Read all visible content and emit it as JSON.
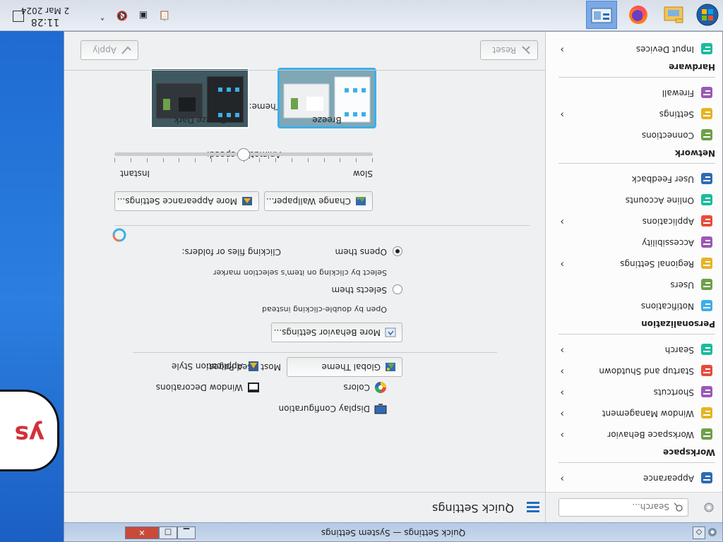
{
  "window": {
    "title": "Quick Settings — System Settings"
  },
  "sidebar": {
    "search_placeholder": "Search...",
    "items": [
      {
        "label": "Appearance",
        "icon": "appearance-icon",
        "chevron": true
      },
      {
        "category": "Workspace"
      },
      {
        "label": "Workspace Behavior",
        "icon": "workspace-behavior-icon",
        "chevron": true
      },
      {
        "label": "Window Management",
        "icon": "window-management-icon",
        "chevron": true
      },
      {
        "label": "Shortcuts",
        "icon": "shortcuts-icon",
        "chevron": true
      },
      {
        "label": "Startup and Shutdown",
        "icon": "startup-icon",
        "chevron": true
      },
      {
        "label": "Search",
        "icon": "search-icon",
        "chevron": true
      },
      {
        "category": "Personalization"
      },
      {
        "label": "Notifications",
        "icon": "notifications-icon",
        "chevron": false
      },
      {
        "label": "Users",
        "icon": "users-icon",
        "chevron": false
      },
      {
        "label": "Regional Settings",
        "icon": "regional-icon",
        "chevron": true
      },
      {
        "label": "Accessibility",
        "icon": "accessibility-icon",
        "chevron": false
      },
      {
        "label": "Applications",
        "icon": "applications-icon",
        "chevron": true
      },
      {
        "label": "Online Accounts",
        "icon": "online-accounts-icon",
        "chevron": false
      },
      {
        "label": "User Feedback",
        "icon": "user-feedback-icon",
        "chevron": false
      },
      {
        "category": "Network"
      },
      {
        "label": "Connections",
        "icon": "connections-icon",
        "chevron": false
      },
      {
        "label": "Settings",
        "icon": "network-settings-icon",
        "chevron": true
      },
      {
        "label": "Firewall",
        "icon": "firewall-icon",
        "chevron": false
      },
      {
        "category": "Hardware"
      },
      {
        "label": "Input Devices",
        "icon": "input-devices-icon",
        "chevron": true
      }
    ]
  },
  "main": {
    "page_title": "Quick Settings",
    "theme_label": "Theme:",
    "themes": [
      {
        "name": "Breeze",
        "selected": true
      },
      {
        "name": "Breeze Dark",
        "selected": false
      }
    ],
    "animation_label": "Animation speed:",
    "animation_slow": "Slow",
    "animation_instant": "Instant",
    "animation_speed": 0.5,
    "change_wallpaper": "Change Wallpaper...",
    "more_appearance": "More Appearance Settings...",
    "clicking_label": "Clicking files or folders:",
    "opens_them": "Opens them",
    "opens_hint": "Select by clicking on item's selection marker",
    "selects_them": "Selects them",
    "selects_hint": "Open by double-clicking instead",
    "more_behavior": "More Behavior Settings...",
    "most_used_label": "Most Used Pages:",
    "most_used": [
      "Global Theme",
      "Application Style",
      "Colors",
      "Window Decorations",
      "Display Configuration"
    ],
    "reset": "Reset",
    "apply": "Apply"
  },
  "taskbar": {
    "time": "11:28",
    "date": "2 Mar 2024"
  },
  "desktop": {
    "bubble_text": "ys"
  },
  "colors": {
    "accent": "#3daee9",
    "selection": "#1e6bbf"
  }
}
